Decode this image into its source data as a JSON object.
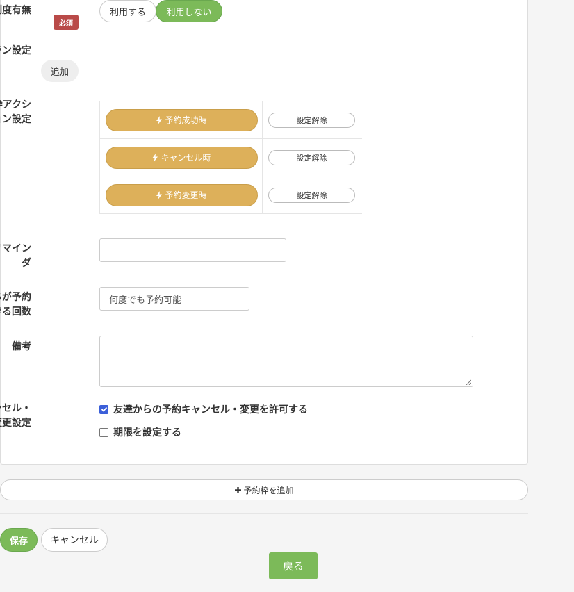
{
  "approval": {
    "label": "承認制度有無",
    "required_badge": "必須",
    "options": [
      "利用する",
      "利用しない"
    ],
    "selected": "利用しない"
  },
  "plan": {
    "label": "プラン設定",
    "add_label": "追加"
  },
  "slot_action": {
    "label_line1": "予約枠アクシ",
    "label_line2": "ョン設定",
    "rows": [
      {
        "action": "予約成功時",
        "clear": "設定解除"
      },
      {
        "action": "キャンセル時",
        "clear": "設定解除"
      },
      {
        "action": "予約変更時",
        "clear": "設定解除"
      }
    ]
  },
  "reminder": {
    "label_line1": "予約リマイン",
    "label_line2": "ダ",
    "value": ""
  },
  "booking_count": {
    "label_line1": "友だちが予約",
    "label_line2": "できる回数",
    "value": "何度でも予約可能"
  },
  "notes": {
    "label": "備考",
    "value": ""
  },
  "cancel_settings": {
    "label_line1": "キャンセル・",
    "label_line2": "予約変更設定",
    "options": [
      {
        "label": "友達からの予約キャンセル・変更を許可する",
        "checked": true
      },
      {
        "label": "期限を設定する",
        "checked": false
      }
    ]
  },
  "add_slot_label": "予約枠を追加",
  "footer": {
    "save_label": "保存",
    "cancel_label": "キャンセル",
    "back_label": "戻る"
  },
  "colors": {
    "green": "#7cba59",
    "gold": "#ddb05a",
    "required_red": "#b94a48",
    "checkbox_blue": "#3b5fd9"
  }
}
